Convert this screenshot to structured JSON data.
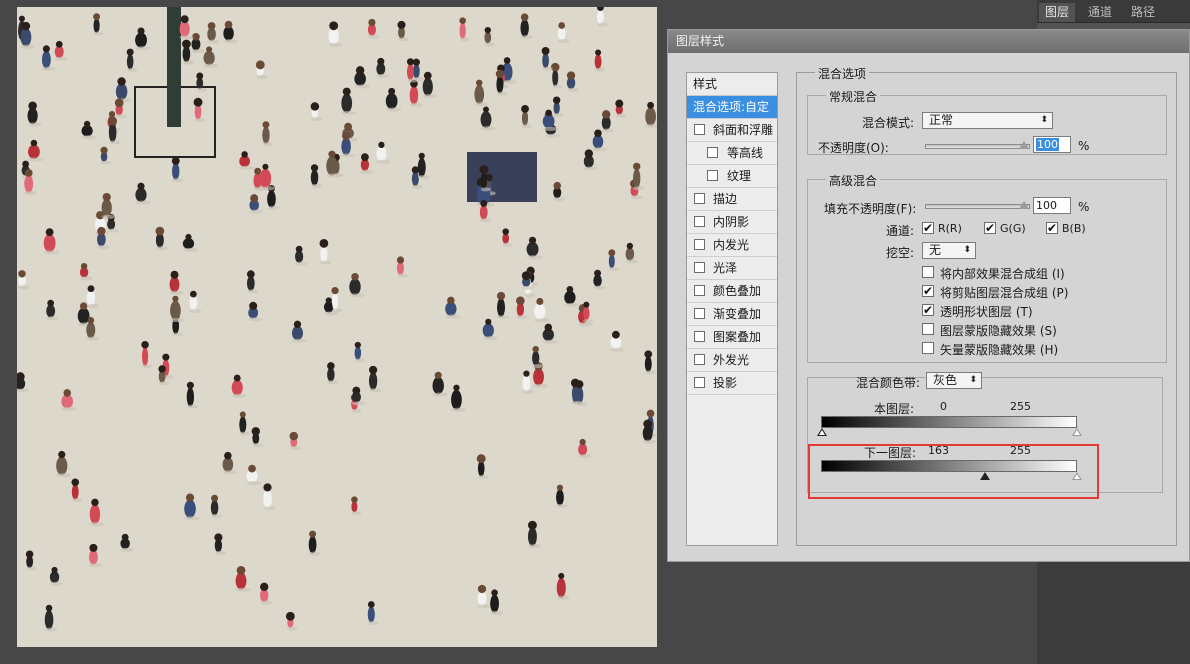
{
  "panel": {
    "tabs": [
      "图层",
      "通道",
      "路径"
    ]
  },
  "dialog": {
    "title": "图层样式",
    "styles_header": "样式",
    "styles": [
      {
        "label": "混合选项:自定",
        "selected": true,
        "sub": false,
        "checkbox": false
      },
      {
        "label": "斜面和浮雕",
        "selected": false,
        "sub": false,
        "checkbox": true
      },
      {
        "label": "等高线",
        "selected": false,
        "sub": true,
        "checkbox": true
      },
      {
        "label": "纹理",
        "selected": false,
        "sub": true,
        "checkbox": true
      },
      {
        "label": "描边",
        "selected": false,
        "sub": false,
        "checkbox": true
      },
      {
        "label": "内阴影",
        "selected": false,
        "sub": false,
        "checkbox": true
      },
      {
        "label": "内发光",
        "selected": false,
        "sub": false,
        "checkbox": true
      },
      {
        "label": "光泽",
        "selected": false,
        "sub": false,
        "checkbox": true
      },
      {
        "label": "颜色叠加",
        "selected": false,
        "sub": false,
        "checkbox": true
      },
      {
        "label": "渐变叠加",
        "selected": false,
        "sub": false,
        "checkbox": true
      },
      {
        "label": "图案叠加",
        "selected": false,
        "sub": false,
        "checkbox": true
      },
      {
        "label": "外发光",
        "selected": false,
        "sub": false,
        "checkbox": true
      },
      {
        "label": "投影",
        "selected": false,
        "sub": false,
        "checkbox": true
      }
    ],
    "blend_options": {
      "section_title": "混合选项",
      "general": {
        "title": "常规混合",
        "mode_label": "混合模式:",
        "mode_value": "正常",
        "opacity_label": "不透明度(O):",
        "opacity_value": "100",
        "percent": "%"
      },
      "advanced": {
        "title": "高级混合",
        "fill_label": "填充不透明度(F):",
        "fill_value": "100",
        "percent": "%",
        "channels_label": "通道:",
        "channels": [
          {
            "label": "R(R)",
            "checked": true
          },
          {
            "label": "G(G)",
            "checked": true
          },
          {
            "label": "B(B)",
            "checked": true
          }
        ],
        "knockout_label": "挖空:",
        "knockout_value": "无",
        "options": [
          {
            "label": "将内部效果混合成组 (I)",
            "checked": false
          },
          {
            "label": "将剪贴图层混合成组 (P)",
            "checked": true
          },
          {
            "label": "透明形状图层 (T)",
            "checked": true
          },
          {
            "label": "图层蒙版隐藏效果 (S)",
            "checked": false
          },
          {
            "label": "矢量蒙版隐藏效果 (H)",
            "checked": false
          }
        ]
      },
      "blend_if": {
        "label": "混合颜色带:",
        "value": "灰色",
        "this_layer": {
          "label": "本图层:",
          "low": "0",
          "high": "255"
        },
        "underlying": {
          "label": "下一图层:",
          "low": "163",
          "high": "255"
        }
      }
    }
  },
  "colors": {
    "highlight_box": "#e53935",
    "selection": "#3b8fe0"
  }
}
